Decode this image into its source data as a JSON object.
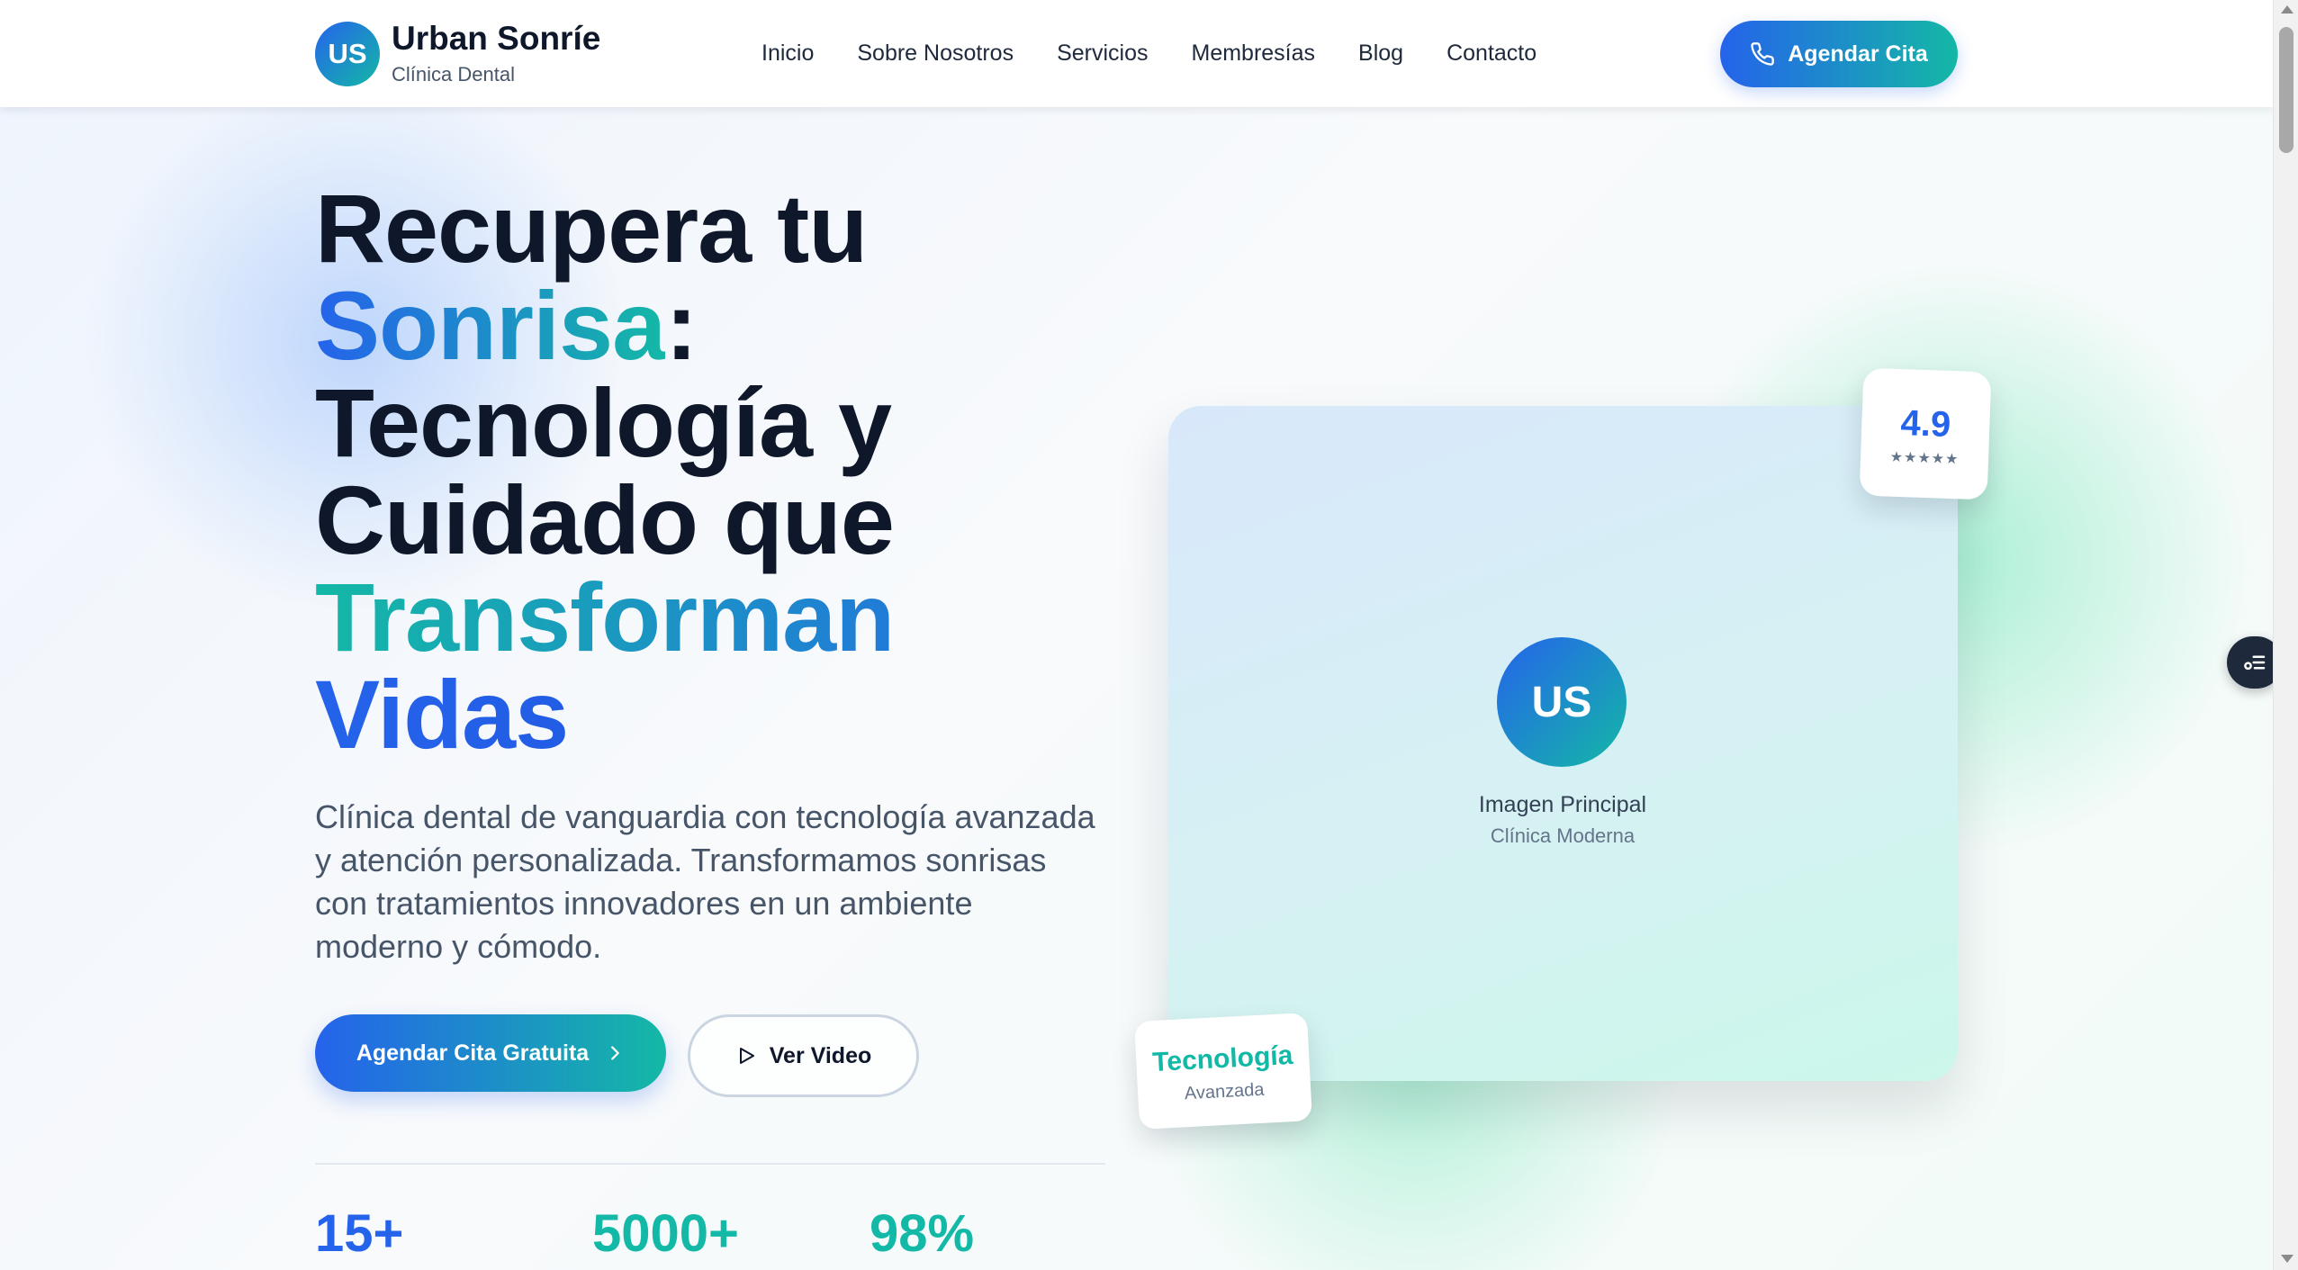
{
  "header": {
    "logo_initials": "US",
    "brand_name": "Urban Sonríe",
    "brand_subtitle": "Clínica Dental",
    "nav": [
      "Inicio",
      "Sobre Nosotros",
      "Servicios",
      "Membresías",
      "Blog",
      "Contacto"
    ],
    "cta_label": "Agendar Cita",
    "cta_icon": "phone-icon"
  },
  "hero": {
    "title_part1": "Recupera tu",
    "title_highlight1": "Sonrisa",
    "title_colon": ":",
    "title_part2": "Tecnología y",
    "title_part3": "Cuidado que",
    "title_highlight2": "Transforman",
    "title_highlight3": "Vidas",
    "description": "Clínica dental de vanguardia con tecnología avanzada y atención personalizada. Transformamos sonrisas con tratamientos innovadores en un ambiente moderno y cómodo.",
    "primary_button": "Agendar Cita Gratuita",
    "secondary_button": "Ver Video",
    "stats": [
      "15+",
      "5000+",
      "98%"
    ]
  },
  "image_card": {
    "badge_initials": "US",
    "label": "Imagen Principal",
    "sublabel": "Clínica Moderna"
  },
  "rating_card": {
    "value": "4.9",
    "stars": "★★★★★"
  },
  "tech_card": {
    "title": "Tecnología",
    "subtitle": "Avanzada"
  },
  "colors": {
    "primary": "#2563eb",
    "accent": "#14b8a6",
    "text_dark": "#0f172a",
    "text_muted": "#475569"
  }
}
